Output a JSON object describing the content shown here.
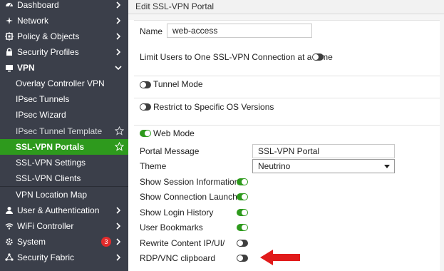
{
  "sidebar": {
    "items": [
      {
        "label": "Dashboard",
        "icon": "dashboard-icon"
      },
      {
        "label": "Network",
        "icon": "network-icon"
      },
      {
        "label": "Policy & Objects",
        "icon": "policy-icon"
      },
      {
        "label": "Security Profiles",
        "icon": "lock-icon"
      },
      {
        "label": "VPN",
        "icon": "monitor-icon"
      },
      {
        "label": "Overlay Controller VPN"
      },
      {
        "label": "IPsec Tunnels"
      },
      {
        "label": "IPsec Wizard"
      },
      {
        "label": "IPsec Tunnel Template"
      },
      {
        "label": "SSL-VPN Portals"
      },
      {
        "label": "SSL-VPN Settings"
      },
      {
        "label": "SSL-VPN Clients"
      },
      {
        "label": "VPN Location Map"
      },
      {
        "label": "User & Authentication",
        "icon": "user-icon"
      },
      {
        "label": "WiFi Controller",
        "icon": "wifi-icon"
      },
      {
        "label": "System",
        "icon": "gear-icon",
        "badge": "3"
      },
      {
        "label": "Security Fabric",
        "icon": "fabric-icon"
      }
    ]
  },
  "header": {
    "title": "Edit SSL-VPN Portal"
  },
  "form": {
    "name_label": "Name",
    "name_value": "web-access",
    "limit_label": "Limit Users to One SSL-VPN Connection at a Time",
    "tunnel_mode_label": "Tunnel Mode",
    "restrict_os_label": "Restrict to Specific OS Versions",
    "web_mode_label": "Web Mode",
    "portal_message_label": "Portal Message",
    "portal_message_value": "SSL-VPN Portal",
    "theme_label": "Theme",
    "theme_value": "Neutrino",
    "show_session_info_label": "Show Session Information",
    "show_conn_launcher_label": "Show Connection Launcher",
    "show_login_history_label": "Show Login History",
    "user_bookmarks_label": "User Bookmarks",
    "rewrite_content_label": "Rewrite Content IP/UI/",
    "rdp_vnc_label": "RDP/VNC clipboard"
  },
  "colors": {
    "sidebar_bg": "#3b3f4a",
    "active_green": "#2e9a1d",
    "badge_red": "#e32b2b",
    "arrow_red": "#e11b1b"
  }
}
